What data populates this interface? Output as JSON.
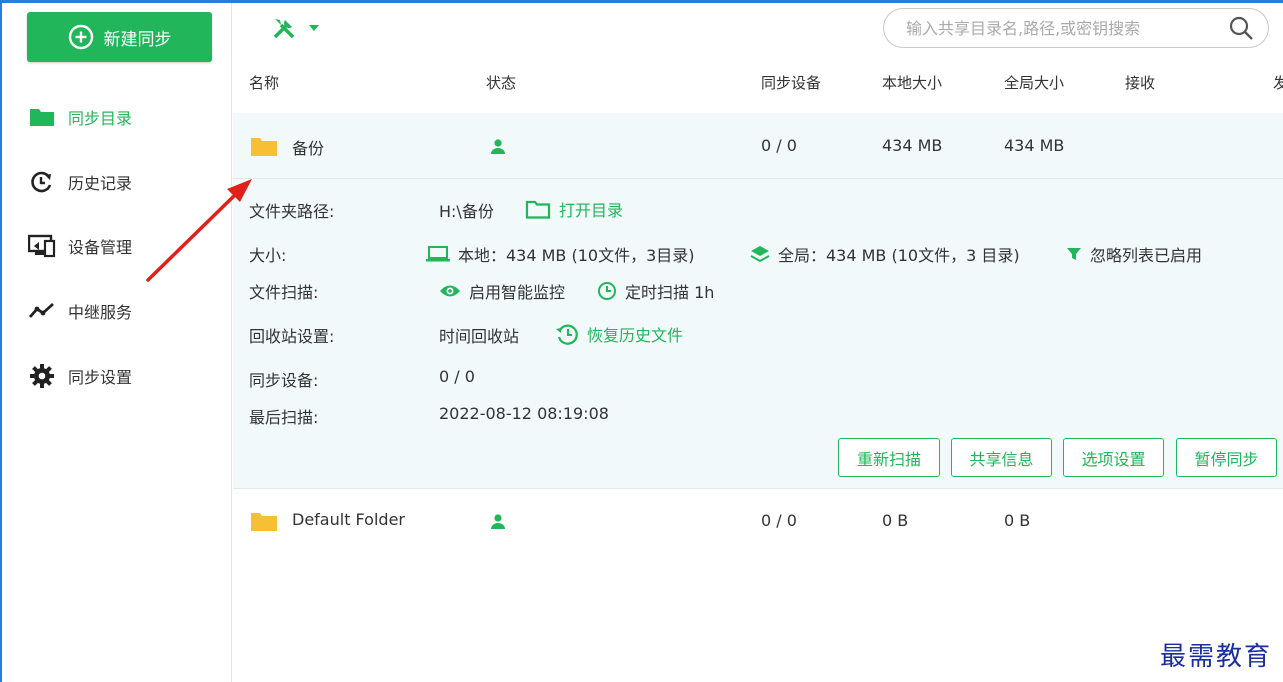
{
  "sidebar": {
    "new_sync_label": "新建同步",
    "items": [
      {
        "label": "同步目录",
        "icon": "folder-icon"
      },
      {
        "label": "历史记录",
        "icon": "history-icon"
      },
      {
        "label": "设备管理",
        "icon": "device-icon"
      },
      {
        "label": "中继服务",
        "icon": "relay-icon"
      },
      {
        "label": "同步设置",
        "icon": "gear-icon"
      }
    ]
  },
  "toolbar": {
    "tools_icon": "tools-icon",
    "search_placeholder": "输入共享目录名,路径,或密钥搜索"
  },
  "table": {
    "columns": [
      "名称",
      "状态",
      "同步设备",
      "本地大小",
      "全局大小",
      "接收",
      "发"
    ],
    "rows": [
      {
        "name": "备份",
        "status_icon": "user-icon",
        "devices": "0 / 0",
        "local_size": "434 MB",
        "global_size": "434 MB"
      },
      {
        "name": "Default Folder",
        "status_icon": "user-icon",
        "devices": "0 / 0",
        "local_size": "0 B",
        "global_size": "0 B"
      }
    ]
  },
  "details": {
    "path_label": "文件夹路径:",
    "path_value": "H:\\备份",
    "open_dir_label": "打开目录",
    "size_label": "大小:",
    "size_local": "本地：434 MB (10文件，3目录)",
    "size_global": "全局：434 MB (10文件，3 目录)",
    "ignore_list": "忽略列表已启用",
    "scan_label": "文件扫描:",
    "watch_label": "启用智能监控",
    "interval_label": "定时扫描 1h",
    "recycle_label": "回收站设置:",
    "recycle_value": "时间回收站",
    "restore_label": "恢复历史文件",
    "devices_label": "同步设备:",
    "devices_value": "0 / 0",
    "last_scan_label": "最后扫描:",
    "last_scan_value": "2022-08-12 08:19:08",
    "buttons": [
      "重新扫描",
      "共享信息",
      "选项设置",
      "暂停同步"
    ]
  },
  "watermark": "最需教育",
  "colors": {
    "accent": "#21b65a",
    "folder": "#f7c034",
    "annotation_arrow": "#e0201b",
    "watermark": "#1a2d9e"
  }
}
